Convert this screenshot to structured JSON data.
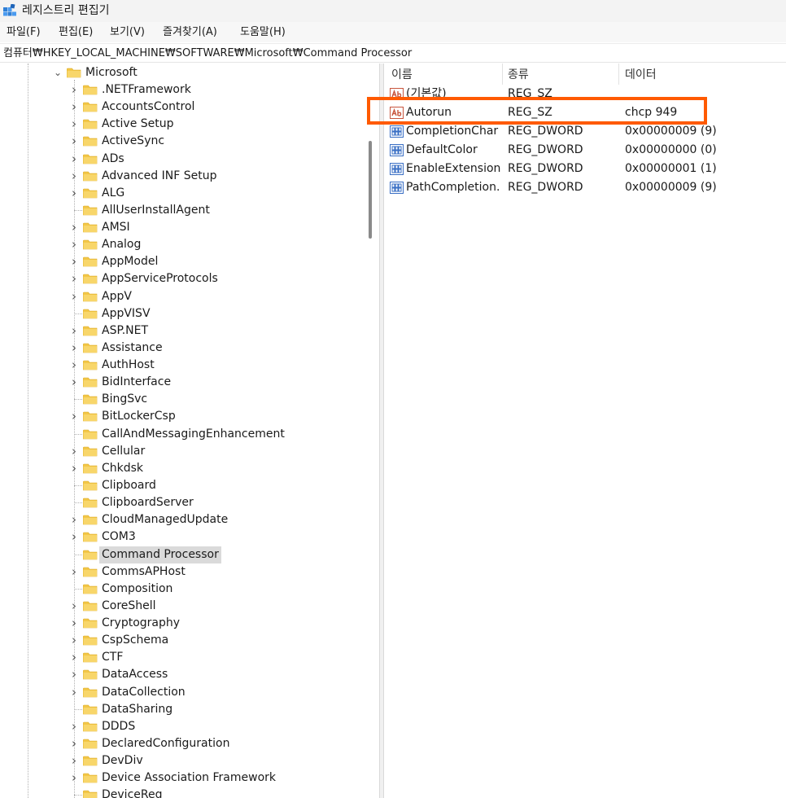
{
  "window": {
    "title": "레지스트리 편집기"
  },
  "menu": [
    "파일(F)",
    "편집(E)",
    "보기(V)",
    "즐겨찾기(A)",
    "도움말(H)"
  ],
  "address": "컴퓨터₩HKEY_LOCAL_MACHINE₩SOFTWARE₩Microsoft₩Command Processor",
  "tree": {
    "parent": "Microsoft",
    "children": [
      {
        "label": ".NETFramework",
        "expandable": true
      },
      {
        "label": "AccountsControl",
        "expandable": true
      },
      {
        "label": "Active Setup",
        "expandable": true
      },
      {
        "label": "ActiveSync",
        "expandable": true
      },
      {
        "label": "ADs",
        "expandable": true
      },
      {
        "label": "Advanced INF Setup",
        "expandable": true
      },
      {
        "label": "ALG",
        "expandable": true
      },
      {
        "label": "AllUserInstallAgent",
        "expandable": false
      },
      {
        "label": "AMSI",
        "expandable": true
      },
      {
        "label": "Analog",
        "expandable": true
      },
      {
        "label": "AppModel",
        "expandable": true
      },
      {
        "label": "AppServiceProtocols",
        "expandable": true
      },
      {
        "label": "AppV",
        "expandable": true
      },
      {
        "label": "AppVISV",
        "expandable": false
      },
      {
        "label": "ASP.NET",
        "expandable": true
      },
      {
        "label": "Assistance",
        "expandable": true
      },
      {
        "label": "AuthHost",
        "expandable": true
      },
      {
        "label": "BidInterface",
        "expandable": true
      },
      {
        "label": "BingSvc",
        "expandable": false
      },
      {
        "label": "BitLockerCsp",
        "expandable": true
      },
      {
        "label": "CallAndMessagingEnhancement",
        "expandable": false
      },
      {
        "label": "Cellular",
        "expandable": true
      },
      {
        "label": "Chkdsk",
        "expandable": true
      },
      {
        "label": "Clipboard",
        "expandable": false
      },
      {
        "label": "ClipboardServer",
        "expandable": false
      },
      {
        "label": "CloudManagedUpdate",
        "expandable": true
      },
      {
        "label": "COM3",
        "expandable": true
      },
      {
        "label": "Command Processor",
        "expandable": false,
        "selected": true
      },
      {
        "label": "CommsAPHost",
        "expandable": true
      },
      {
        "label": "Composition",
        "expandable": false
      },
      {
        "label": "CoreShell",
        "expandable": true
      },
      {
        "label": "Cryptography",
        "expandable": true
      },
      {
        "label": "CspSchema",
        "expandable": true
      },
      {
        "label": "CTF",
        "expandable": true
      },
      {
        "label": "DataAccess",
        "expandable": true
      },
      {
        "label": "DataCollection",
        "expandable": true
      },
      {
        "label": "DataSharing",
        "expandable": false
      },
      {
        "label": "DDDS",
        "expandable": true
      },
      {
        "label": "DeclaredConfiguration",
        "expandable": true
      },
      {
        "label": "DevDiv",
        "expandable": true
      },
      {
        "label": "Device Association Framework",
        "expandable": true
      },
      {
        "label": "DeviceReg",
        "expandable": false
      }
    ]
  },
  "values": {
    "headers": {
      "name": "이름",
      "type": "종류",
      "data": "데이터"
    },
    "rows": [
      {
        "name": "(기본값)",
        "type": "REG_SZ",
        "data": "",
        "icon": "string-value-icon"
      },
      {
        "name": "Autorun",
        "type": "REG_SZ",
        "data": "chcp 949",
        "icon": "string-value-icon"
      },
      {
        "name": "CompletionChar",
        "type": "REG_DWORD",
        "data": "0x00000009 (9)",
        "icon": "binary-value-icon"
      },
      {
        "name": "DefaultColor",
        "type": "REG_DWORD",
        "data": "0x00000000 (0)",
        "icon": "binary-value-icon"
      },
      {
        "name": "EnableExtensions",
        "type": "REG_DWORD",
        "data": "0x00000001 (1)",
        "icon": "binary-value-icon"
      },
      {
        "name": "PathCompletion...",
        "type": "REG_DWORD",
        "data": "0x00000009 (9)",
        "icon": "binary-value-icon"
      }
    ]
  },
  "colors": {
    "highlight": "#ff5a00",
    "folder": "#f3c748",
    "selection": "#dadada"
  }
}
